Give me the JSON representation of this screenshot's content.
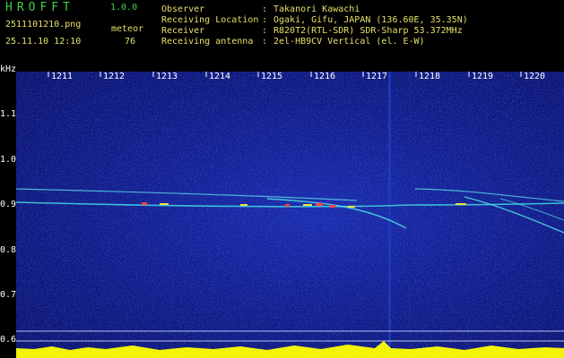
{
  "header": {
    "app_title": "HROFFT",
    "app_version": "1.0.0",
    "filename": "2511101210.png",
    "datetime": "25.11.10 12:10",
    "meteor_label": "meteor",
    "meteor_count": "76",
    "info": [
      {
        "label": "Observer",
        "value": "Takanori Kawachi"
      },
      {
        "label": "Receiving Location",
        "value": "Ogaki, Gifu, JAPAN (136.60E, 35.35N)"
      },
      {
        "label": "Receiver",
        "value": "R820T2(RTL-SDR) SDR-Sharp 53.372MHz"
      },
      {
        "label": "Receiving antenna",
        "value": "2el-HB9CV Vertical (el. E-W)"
      }
    ]
  },
  "axis": {
    "unit": "kHz",
    "y_ticks": [
      "1.1",
      "1.0",
      "0.9",
      "0.8",
      "0.7",
      "0.6"
    ],
    "x_ticks": [
      "1211",
      "1212",
      "1213",
      "1214",
      "1215",
      "1216",
      "1217",
      "1218",
      "1219",
      "1220"
    ]
  },
  "colors": {
    "accent_green": "#3fd24a",
    "text_yellow": "#e6e06a",
    "background": "#000000",
    "spectrogram_blue": "#101c8a",
    "signal_cyan": "#40e0e0",
    "signal_peak": "#ff3030",
    "baseline_yellow": "#ffff00"
  }
}
